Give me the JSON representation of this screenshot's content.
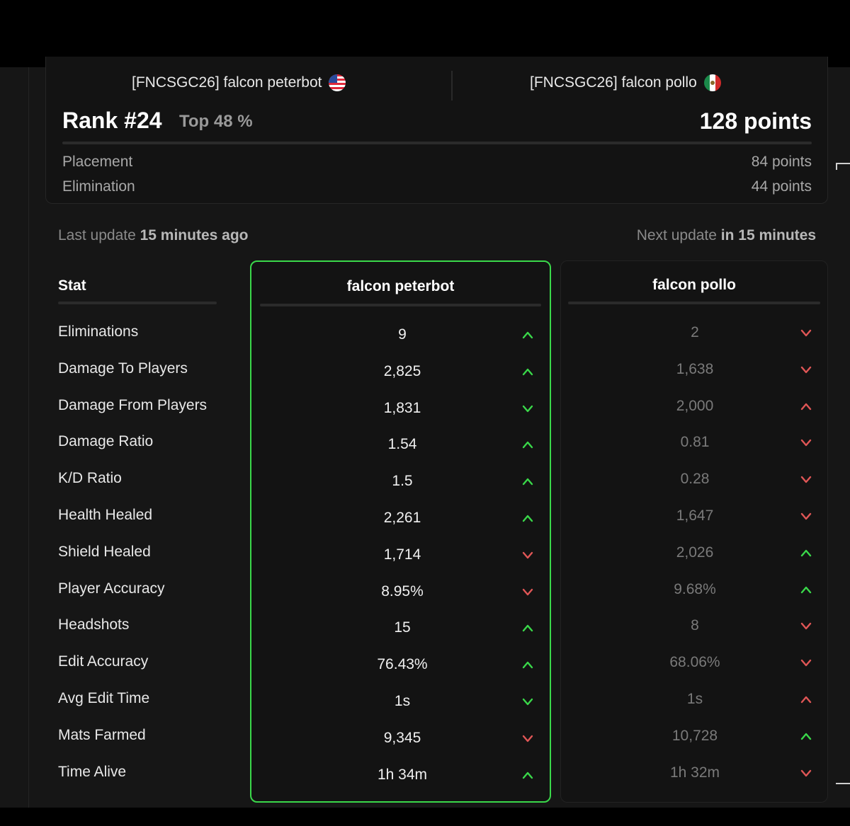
{
  "team": {
    "player1_full": "[FNCSGC26] falcon peterbot",
    "player2_full": "[FNCSGC26] falcon pollo",
    "player1_flag": "us-flag-icon",
    "player2_flag": "mexico-flag-icon",
    "rank": "Rank #24",
    "top_percent": "Top 48 %",
    "total_points": "128 points",
    "breakdown": [
      {
        "label": "Placement",
        "value": "84 points"
      },
      {
        "label": "Elimination",
        "value": "44 points"
      }
    ]
  },
  "updates": {
    "last_prefix": "Last update",
    "last_value": "15 minutes ago",
    "next_prefix": "Next update",
    "next_value": "in 15 minutes"
  },
  "stats": {
    "header": "Stat",
    "player1_name": "falcon peterbot",
    "player2_name": "falcon pollo",
    "rows": [
      {
        "label": "Eliminations",
        "p1": "9",
        "p1_dir": "up",
        "p2": "2",
        "p2_dir": "down"
      },
      {
        "label": "Damage To Players",
        "p1": "2,825",
        "p1_dir": "up",
        "p2": "1,638",
        "p2_dir": "down"
      },
      {
        "label": "Damage From Players",
        "p1": "1,831",
        "p1_dir": "down-good",
        "p2": "2,000",
        "p2_dir": "up-bad"
      },
      {
        "label": "Damage Ratio",
        "p1": "1.54",
        "p1_dir": "up",
        "p2": "0.81",
        "p2_dir": "down"
      },
      {
        "label": "K/D Ratio",
        "p1": "1.5",
        "p1_dir": "up",
        "p2": "0.28",
        "p2_dir": "down"
      },
      {
        "label": "Health Healed",
        "p1": "2,261",
        "p1_dir": "up",
        "p2": "1,647",
        "p2_dir": "down"
      },
      {
        "label": "Shield Healed",
        "p1": "1,714",
        "p1_dir": "down",
        "p2": "2,026",
        "p2_dir": "up"
      },
      {
        "label": "Player Accuracy",
        "p1": "8.95%",
        "p1_dir": "down",
        "p2": "9.68%",
        "p2_dir": "up"
      },
      {
        "label": "Headshots",
        "p1": "15",
        "p1_dir": "up",
        "p2": "8",
        "p2_dir": "down"
      },
      {
        "label": "Edit Accuracy",
        "p1": "76.43%",
        "p1_dir": "up",
        "p2": "68.06%",
        "p2_dir": "down"
      },
      {
        "label": "Avg Edit Time",
        "p1": "1s",
        "p1_dir": "down-good",
        "p2": "1s",
        "p2_dir": "up-bad"
      },
      {
        "label": "Mats Farmed",
        "p1": "9,345",
        "p1_dir": "down",
        "p2": "10,728",
        "p2_dir": "up"
      },
      {
        "label": "Time Alive",
        "p1": "1h 34m",
        "p1_dir": "up",
        "p2": "1h 32m",
        "p2_dir": "down"
      }
    ]
  },
  "colors": {
    "good": "#3ad84a",
    "bad": "#e05656",
    "highlight_border": "#3ad84a"
  }
}
